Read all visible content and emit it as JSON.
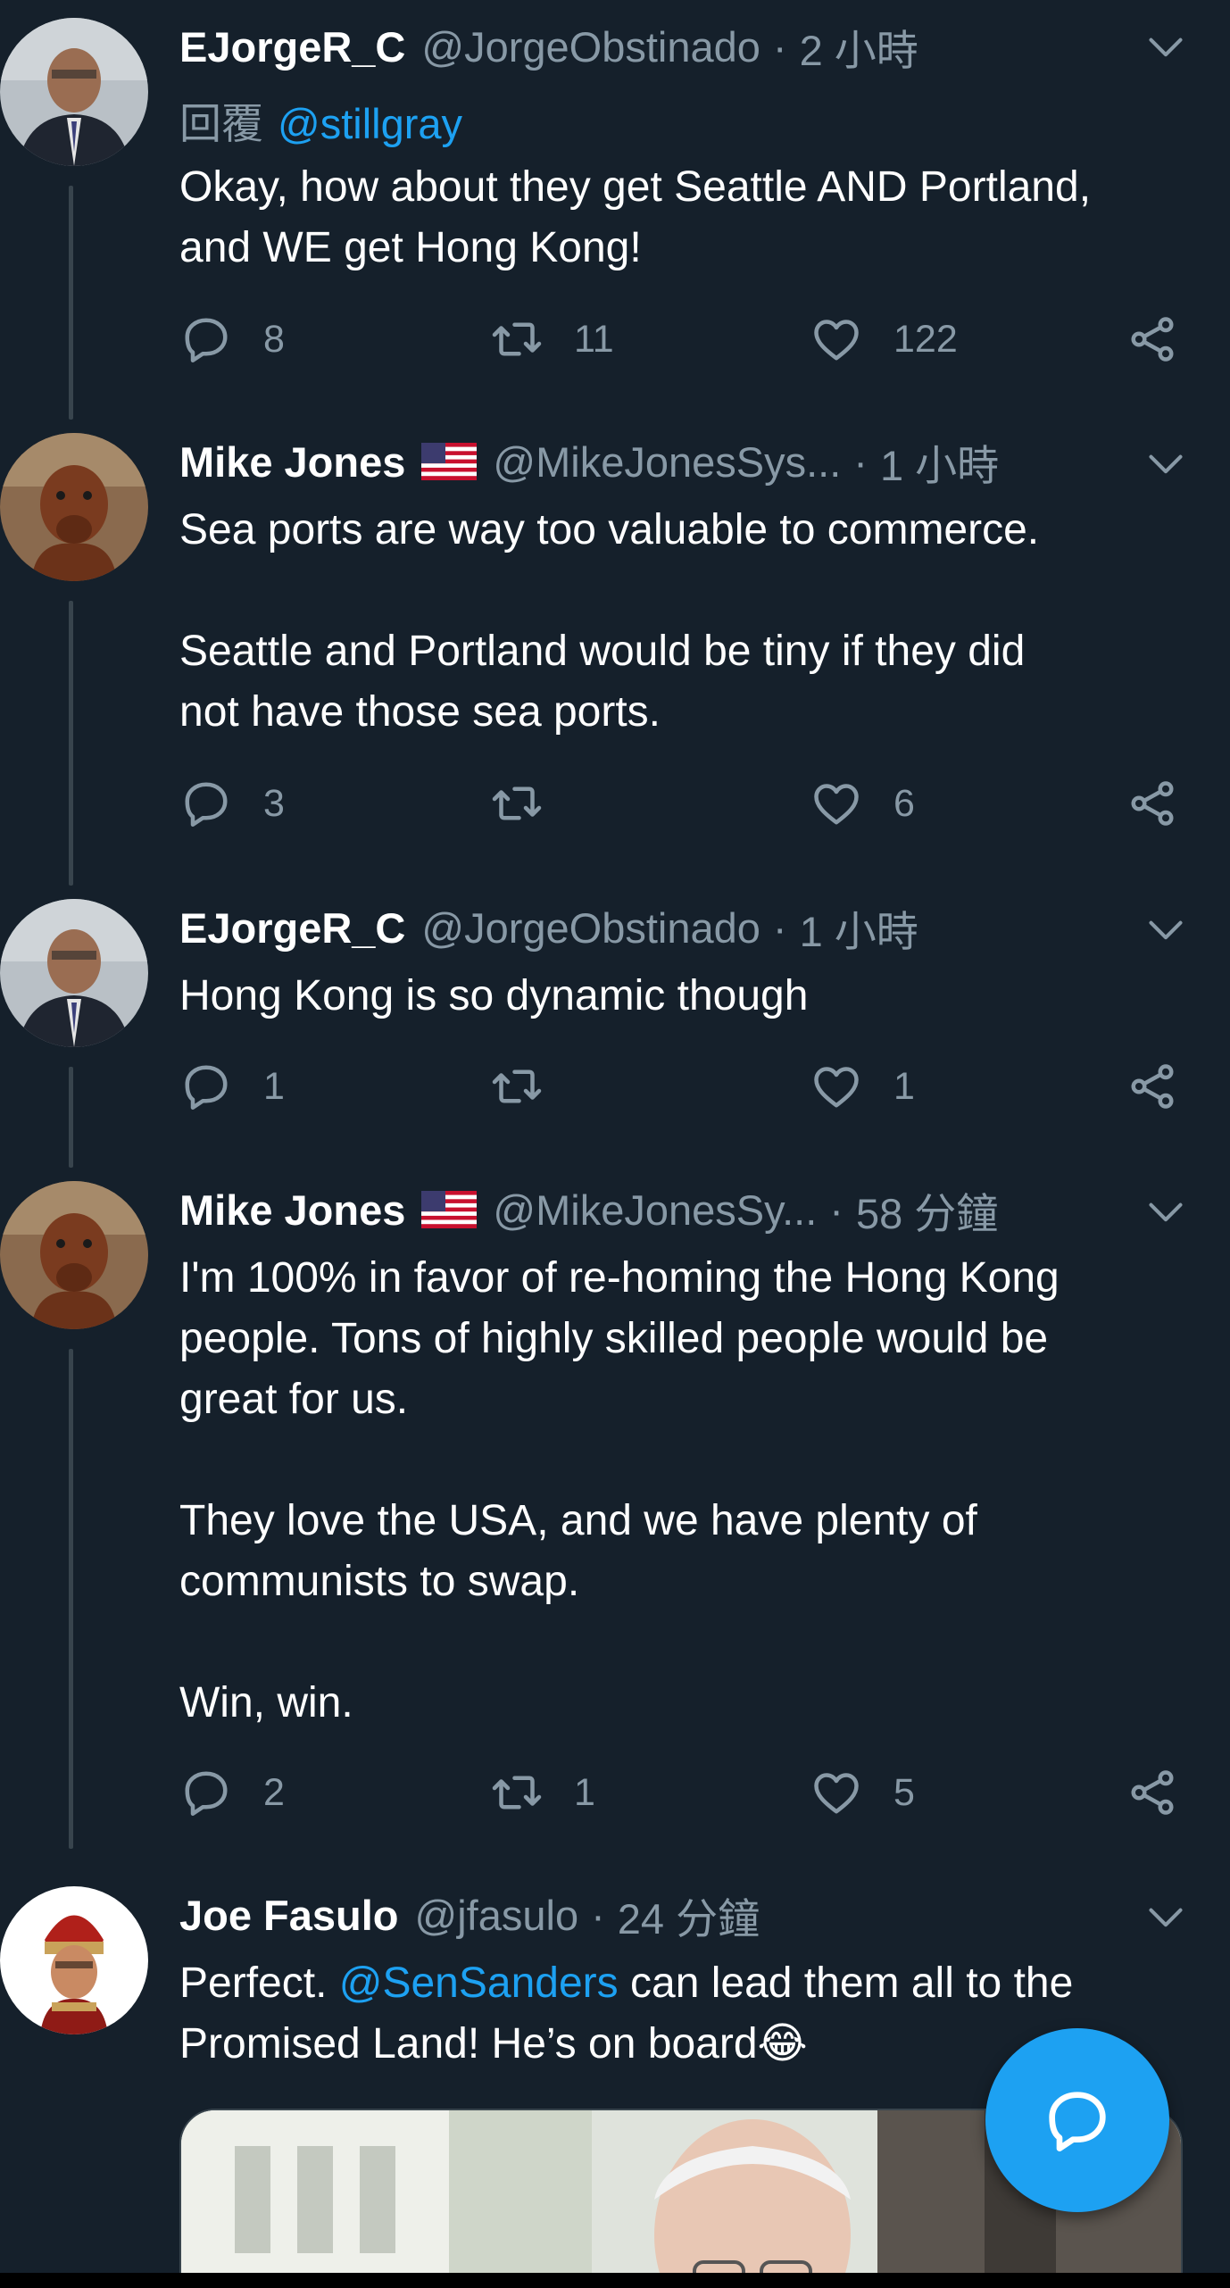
{
  "colors": {
    "background": "#15202b",
    "secondary_text": "#8899a6",
    "accent": "#1da1f2",
    "thread_line": "#38444d"
  },
  "tweets": [
    {
      "name": "EJorgeR_C",
      "handle": "@JorgeObstinado",
      "time": "2 小時",
      "replying_label": "回覆",
      "replying_to": "@stillgray",
      "text": "Okay, how about they get Seattle AND Portland,\nand WE get Hong Kong!",
      "reply_count": "8",
      "retweet_count": "11",
      "like_count": "122",
      "icons": [
        "chevron-down-icon",
        "reply-icon",
        "retweet-icon",
        "like-icon",
        "share-icon"
      ]
    },
    {
      "name": "Mike Jones",
      "flag": "us-flag-icon",
      "handle": "@MikeJonesSys...",
      "time": "1 小時",
      "text": "Sea ports are way too valuable to commerce.\n\nSeattle and Portland would be tiny if they did\nnot have those sea ports.",
      "reply_count": "3",
      "retweet_count": "",
      "like_count": "6"
    },
    {
      "name": "EJorgeR_C",
      "handle": "@JorgeObstinado",
      "time": "1 小時",
      "text": "Hong Kong is so dynamic though",
      "reply_count": "1",
      "retweet_count": "",
      "like_count": "1"
    },
    {
      "name": "Mike Jones",
      "flag": "us-flag-icon",
      "handle": "@MikeJonesSy...",
      "time": "58 分鐘",
      "text": "I'm 100% in favor of re-homing the Hong Kong\npeople. Tons of highly skilled people would be\ngreat for us.\n\nThey love the USA, and we have plenty of\ncommunists to swap.\n\nWin, win.",
      "reply_count": "2",
      "retweet_count": "1",
      "like_count": "5"
    },
    {
      "name": "Joe Fasulo",
      "handle": "@jfasulo",
      "time": "24 分鐘",
      "text_before": "Perfect. ",
      "mention": "@SenSanders",
      "text_after": " can lead them all to the\nPromised Land! He’s on board😂"
    }
  ],
  "fab": {
    "icon": "compose-reply-icon"
  }
}
